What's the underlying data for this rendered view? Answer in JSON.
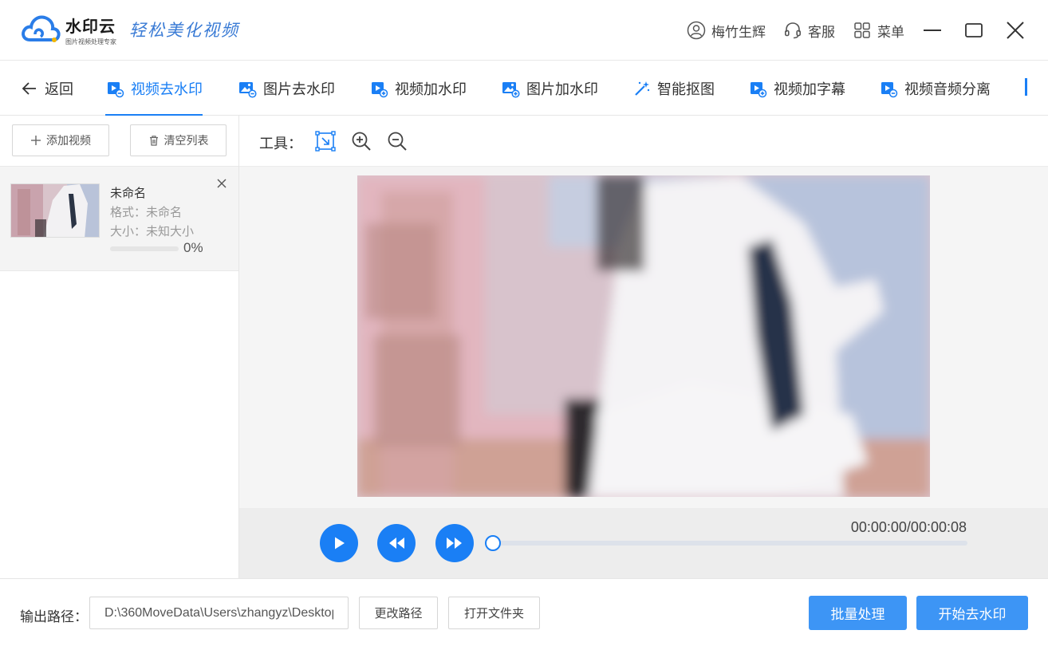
{
  "app": {
    "brand_name": "水印云",
    "brand_sub": "图片视频处理专家",
    "slogan": "轻松美化视频"
  },
  "title_bar": {
    "user": "梅竹生辉",
    "service": "客服",
    "menu": "菜单"
  },
  "nav": {
    "back": "返回",
    "tabs": [
      {
        "label": "视频去水印",
        "active": true
      },
      {
        "label": "图片去水印"
      },
      {
        "label": "视频加水印"
      },
      {
        "label": "图片加水印"
      },
      {
        "label": "智能抠图"
      },
      {
        "label": "视频加字幕"
      },
      {
        "label": "视频音频分离"
      }
    ]
  },
  "left_panel": {
    "add_video": "添加视频",
    "clear_list": "清空列表",
    "files": [
      {
        "name": "未命名",
        "format": "格式：未命名",
        "size": "大小：未知大小",
        "progress": 0,
        "progress_label": "0%"
      }
    ]
  },
  "tools": {
    "label": "工具："
  },
  "player": {
    "timecode": "00:00:00/00:00:08",
    "position": 0
  },
  "bottom": {
    "output_label": "输出路径：",
    "output_path": "D:\\360MoveData\\Users\\zhangyz\\Desktop",
    "change_path": "更改路径",
    "open_folder": "打开文件夹",
    "batch": "批量处理",
    "start": "开始去水印"
  },
  "colors": {
    "accent": "#1a7ff5",
    "primary_button": "#3d95f5"
  }
}
